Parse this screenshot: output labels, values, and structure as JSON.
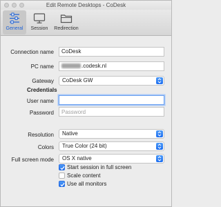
{
  "window": {
    "title": "Edit Remote Desktops - CoDesk"
  },
  "toolbar": {
    "tabs": [
      {
        "label": "General",
        "icon": "sliders-icon"
      },
      {
        "label": "Session",
        "icon": "monitor-icon"
      },
      {
        "label": "Redirection",
        "icon": "folder-icon"
      }
    ]
  },
  "form": {
    "connection_name": {
      "label": "Connection name",
      "value": "CoDesk"
    },
    "pc_name": {
      "label": "PC name",
      "value_suffix": ".codesk.nl"
    },
    "gateway": {
      "label": "Gateway",
      "value": "CoDesk GW"
    },
    "credentials_heading": "Credentials",
    "user_name": {
      "label": "User name",
      "value": ""
    },
    "password": {
      "label": "Password",
      "placeholder": "Password"
    },
    "resolution": {
      "label": "Resolution",
      "value": "Native"
    },
    "colors": {
      "label": "Colors",
      "value": "True Color (24 bit)"
    },
    "full_screen_mode": {
      "label": "Full screen mode",
      "value": "OS X native"
    },
    "checkboxes": [
      {
        "label": "Start session in full screen",
        "checked": true
      },
      {
        "label": "Scale content",
        "checked": false
      },
      {
        "label": "Use all monitors",
        "checked": true
      }
    ]
  },
  "colors": {
    "accent": "#1d6ef0",
    "window_bg": "#ececec"
  }
}
